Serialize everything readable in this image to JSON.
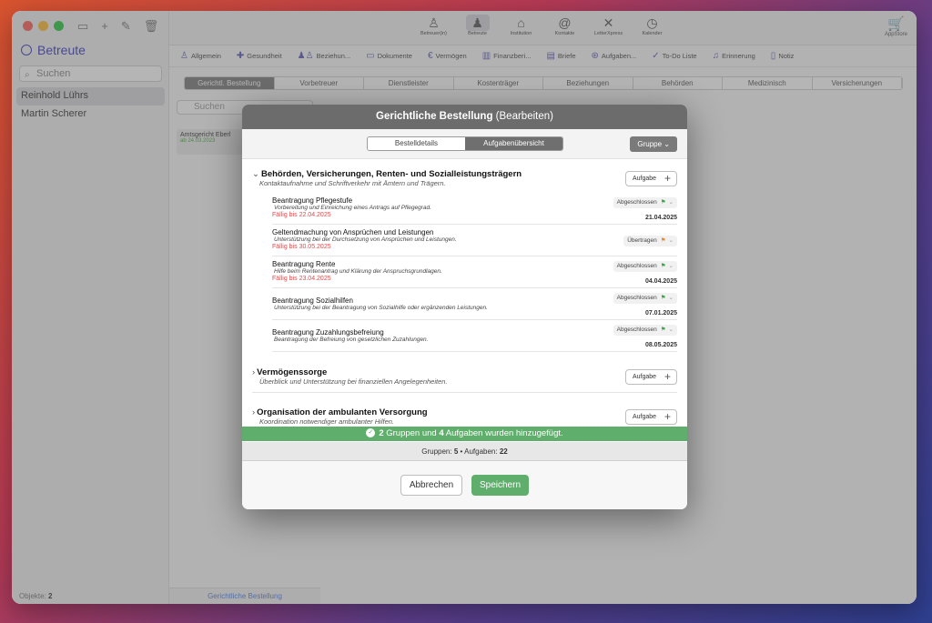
{
  "sidebar": {
    "title": "Betreute",
    "search_placeholder": "Suchen",
    "items": [
      "Reinhold Lührs",
      "Martin Scherer"
    ],
    "footer_label": "Objekte:",
    "footer_count": "2"
  },
  "toolbar": {
    "buttons": [
      "Betreuer(in)",
      "Betreute",
      "Institution",
      "Kontakte",
      "LetterXpress",
      "Kalender"
    ],
    "appstore": "AppStore"
  },
  "categories": [
    "Allgemein",
    "Gesundheit",
    "Beziehun...",
    "Dokumente",
    "Vermögen",
    "Finanzberi...",
    "Briefe",
    "Aufgaben...",
    "To-Do Liste",
    "Erinnerung",
    "Notiz"
  ],
  "tabs": [
    "Gerichtl. Bestellung",
    "Vorbetreuer",
    "Dienstleister",
    "Kostenträger",
    "Beziehungen",
    "Behörden",
    "Medizinisch",
    "Versicherungen"
  ],
  "list": {
    "search_placeholder": "Suchen",
    "card_title": "Amtsgericht Eberl",
    "card_date": "ab 24.03.2023",
    "footer": "Gerichtliche Bestellung"
  },
  "modal": {
    "title_bold": "Gerichtliche Bestellung",
    "title_rest": "(Bearbeiten)",
    "segments": [
      "Bestelldetails",
      "Aufgabenübersicht"
    ],
    "group_button": "Gruppe",
    "add_label": "Aufgabe",
    "sections": [
      {
        "title": "Behörden, Versicherungen, Renten- und Sozialleistungsträgern",
        "subtitle": "Kontaktaufnahme und Schriftverkehr mit Ämtern und Trägern.",
        "tasks": [
          {
            "title": "Beantragung Pflegestufe",
            "desc": "Vorbereitung und Einreichung eines Antrags auf Pflegegrad.",
            "due": "Fällig bis 22.04.2025",
            "status": "Abgeschlossen",
            "date": "21.04.2025"
          },
          {
            "title": "Geltendmachung von Ansprüchen und Leistungen",
            "desc": "Unterstützung bei der Durchsetzung von Ansprüchen und Leistungen.",
            "due": "Fällig bis 30.05.2025",
            "status": "Übertragen",
            "date": ""
          },
          {
            "title": "Beantragung Rente",
            "desc": "Hilfe beim Rentenantrag und Klärung der Anspruchsgrundlagen.",
            "due": "Fällig bis 23.04.2025",
            "status": "Abgeschlossen",
            "date": "04.04.2025"
          },
          {
            "title": "Beantragung Sozialhilfen",
            "desc": "Unterstützung bei der Beantragung von Sozialhilfe oder ergänzenden Leistungen.",
            "due": "",
            "status": "Abgeschlossen",
            "date": "07.01.2025"
          },
          {
            "title": "Beantragung Zuzahlungsbefreiung",
            "desc": "Beantragung der Befreiung von gesetzlichen Zuzahlungen.",
            "due": "",
            "status": "Abgeschlossen",
            "date": "08.05.2025"
          }
        ]
      },
      {
        "title": "Vermögenssorge",
        "subtitle": "Überblick und Unterstützung bei finanziellen Angelegenheiten."
      },
      {
        "title": "Organisation der ambulanten Versorgung",
        "subtitle": "Koordination notwendiger ambulanter Hilfen."
      }
    ],
    "banner": {
      "groups": "2",
      "mid": "Gruppen und",
      "tasks": "4",
      "rest": "Aufgaben wurden hinzugefügt."
    },
    "stats": {
      "groups_label": "Gruppen:",
      "groups": "5",
      "tasks_label": "Aufgaben:",
      "tasks": "22"
    },
    "cancel": "Abbrechen",
    "save": "Speichern"
  }
}
